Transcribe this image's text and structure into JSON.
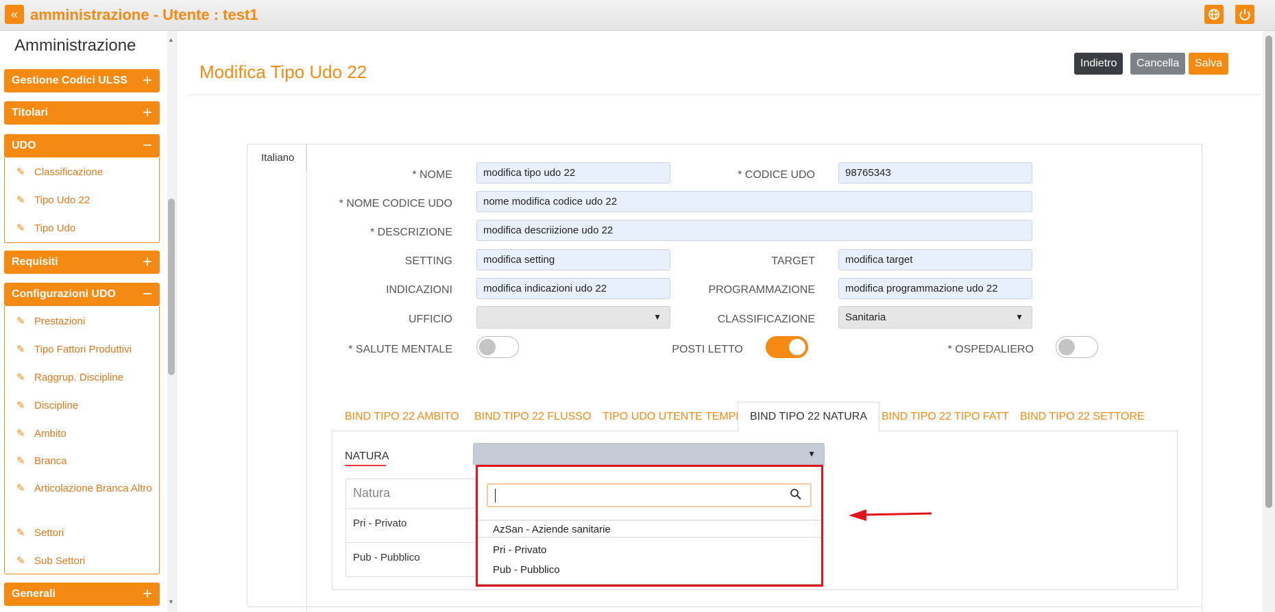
{
  "header": {
    "title": "amministrazione - Utente : test1",
    "collapse_icon": "double-chevron-left-icon",
    "globe_icon": "globe-icon",
    "power_icon": "power-icon"
  },
  "sidebar": {
    "title": "Amministrazione",
    "groups": [
      {
        "label": "Gestione Codici ULSS",
        "expanded": false
      },
      {
        "label": "Titolari",
        "expanded": false
      },
      {
        "label": "UDO",
        "expanded": true,
        "items": [
          "Classificazione",
          "Tipo Udo 22",
          "Tipo Udo"
        ]
      },
      {
        "label": "Requisiti",
        "expanded": false
      },
      {
        "label": "Configurazioni UDO",
        "expanded": true,
        "items": [
          "Prestazioni",
          "Tipo Fattori Produttivi",
          "Raggrup. Discipline",
          "Discipline",
          "Ambito",
          "Branca",
          "Articolazione Branca Altro",
          "Settori",
          "Sub Settori"
        ]
      },
      {
        "label": "Generali",
        "expanded": false
      }
    ],
    "plus_sign": "+",
    "minus_sign": "−"
  },
  "page": {
    "title": "Modifica Tipo Udo 22",
    "buttons": {
      "back": "Indietro",
      "cancel": "Cancella",
      "save": "Salva"
    },
    "colors": {
      "accent": "#f58a12",
      "back_btn": "#3a3d42",
      "cancel_btn": "#7d8288",
      "highlight": "#e0151b"
    }
  },
  "form": {
    "lang_tab": "Italiano",
    "nome": {
      "label": "* NOME",
      "value": "modifica tipo udo 22"
    },
    "codice_udo": {
      "label": "* CODICE UDO",
      "value": "98765343"
    },
    "nome_codice_udo": {
      "label": "* NOME CODICE UDO",
      "value": "nome modifica codice udo 22"
    },
    "descrizione": {
      "label": "* DESCRIZIONE",
      "value": "modifica descriizione udo 22"
    },
    "setting": {
      "label": "SETTING",
      "value": "modifica setting"
    },
    "target": {
      "label": "TARGET",
      "value": "modifica target"
    },
    "indicazioni": {
      "label": "INDICAZIONI",
      "value": "modifica indicazioni udo 22"
    },
    "programmazione": {
      "label": "PROGRAMMAZIONE",
      "value": "modifica programmazione udo 22"
    },
    "ufficio": {
      "label": "UFFICIO",
      "value": ""
    },
    "classificazione": {
      "label": "CLASSIFICAZIONE",
      "value": "Sanitaria"
    },
    "salute_mentale": {
      "label": "* SALUTE MENTALE",
      "on": false
    },
    "posti_letto": {
      "label": "POSTI LETTO",
      "on": true
    },
    "ospedaliero": {
      "label": "* OSPEDALIERO",
      "on": false
    }
  },
  "tabs": [
    "BIND TIPO 22 AMBITO",
    "BIND TIPO 22 FLUSSO",
    "TIPO UDO UTENTE TEMPL",
    "BIND TIPO 22 NATURA",
    "BIND TIPO 22 TIPO FATT",
    "BIND TIPO 22 SETTORE"
  ],
  "active_tab": "BIND TIPO 22 NATURA",
  "natura": {
    "label": "NATURA",
    "table_header": "Natura",
    "table_rows": [
      "Pri - Privato",
      "Pub - Pubblico"
    ],
    "search_value": "",
    "options": [
      "AzSan - Aziende sanitarie",
      "Pri - Privato",
      "Pub - Pubblico"
    ]
  }
}
